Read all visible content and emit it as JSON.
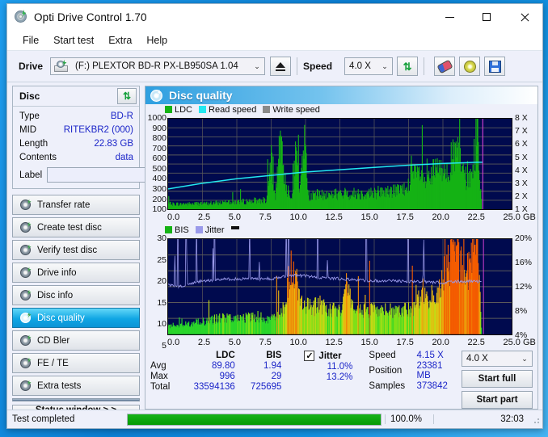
{
  "window": {
    "title": "Opti Drive Control 1.70",
    "icon": "disc-lightning-icon",
    "controls": {
      "minimize": "—",
      "maximize": "□",
      "close": "✕"
    }
  },
  "menu": {
    "items": [
      "File",
      "Start test",
      "Extra",
      "Help"
    ]
  },
  "toolbar": {
    "drive_label": "Drive",
    "drive_value": "(F:)  PLEXTOR BD-R  PX-LB950SA 1.04",
    "eject_title": "Eject",
    "speed_label": "Speed",
    "speed_value": "4.0 X",
    "buttons": [
      "refresh-icon",
      "eraser-icon",
      "disc-tools-icon",
      "save-icon"
    ]
  },
  "disc": {
    "header": "Disc",
    "refresh_icon": "refresh-icon",
    "fields": [
      {
        "key": "Type",
        "value": "BD-R"
      },
      {
        "key": "MID",
        "value": "RITEKBR2 (000)"
      },
      {
        "key": "Length",
        "value": "22.83 GB"
      },
      {
        "key": "Contents",
        "value": "data"
      }
    ],
    "label_key": "Label",
    "label_value": "",
    "label_placeholder": ""
  },
  "nav": {
    "items": [
      {
        "label": "Transfer rate",
        "active": false
      },
      {
        "label": "Create test disc",
        "active": false
      },
      {
        "label": "Verify test disc",
        "active": false
      },
      {
        "label": "Drive info",
        "active": false
      },
      {
        "label": "Disc info",
        "active": false
      },
      {
        "label": "Disc quality",
        "active": true
      },
      {
        "label": "CD Bler",
        "active": false
      },
      {
        "label": "FE / TE",
        "active": false
      },
      {
        "label": "Extra tests",
        "active": false
      }
    ],
    "status_window": "Status window > >"
  },
  "panel": {
    "title": "Disc quality",
    "icon": "disc-lightning-icon"
  },
  "chart_data": [
    {
      "type": "area",
      "title": "LDC / Read speed",
      "legend": [
        {
          "label": "LDC",
          "color": "#15b215"
        },
        {
          "label": "Read speed",
          "color": "#23e8f0"
        },
        {
          "label": "Write speed",
          "color": "#8a8a8a"
        }
      ],
      "legend_position": "top-left",
      "xlabel": "GB",
      "ylabel": "LDC",
      "y2label": "Speed",
      "xlim": [
        0,
        25
      ],
      "ylim": [
        0,
        1000
      ],
      "y2lim": [
        0,
        8
      ],
      "xticks": [
        "0.0",
        "2.5",
        "5.0",
        "7.5",
        "10.0",
        "12.5",
        "15.0",
        "17.5",
        "20.0",
        "22.5",
        "25.0 GB"
      ],
      "yticks": [
        "1000",
        "900",
        "800",
        "700",
        "600",
        "500",
        "400",
        "300",
        "200",
        "100"
      ],
      "y2ticks": [
        "8 X",
        "7 X",
        "6 X",
        "5 X",
        "4 X",
        "3 X",
        "2 X",
        "1 X"
      ],
      "grid": true,
      "background": "#000a4e",
      "series": [
        {
          "name": "LDC",
          "type": "area",
          "color": "#15b215",
          "x": [
            0.0,
            0.3,
            0.6,
            0.9,
            1.2,
            1.5,
            1.8,
            2.1,
            2.4,
            2.7,
            3.0,
            3.3,
            3.6,
            3.9,
            4.2,
            4.5,
            4.8,
            5.1,
            5.4,
            5.7,
            6.0,
            6.3,
            6.6,
            6.9,
            7.2,
            7.5,
            7.8,
            8.1,
            8.4,
            8.7,
            9.0,
            9.3,
            9.6,
            9.9,
            10.2,
            10.5,
            10.8,
            11.1,
            11.4,
            11.7,
            12.0,
            12.3,
            12.6,
            12.9,
            13.2,
            13.5,
            13.8,
            14.1,
            14.4,
            14.7,
            15.0,
            15.3,
            15.6,
            15.9,
            16.2,
            16.5,
            16.8,
            17.1,
            17.4,
            17.7,
            18.0,
            18.3,
            18.6,
            18.9,
            19.2,
            19.5,
            19.8,
            20.1,
            20.4,
            20.7,
            21.0,
            21.3,
            21.6,
            21.9,
            22.2,
            22.5,
            22.8
          ],
          "y": [
            60,
            55,
            58,
            52,
            60,
            57,
            55,
            62,
            58,
            60,
            65,
            62,
            68,
            70,
            95,
            80,
            75,
            78,
            82,
            85,
            88,
            90,
            92,
            95,
            98,
            500,
            110,
            720,
            430,
            200,
            170,
            560,
            180,
            800,
            150,
            140,
            160,
            145,
            155,
            150,
            165,
            160,
            150,
            170,
            155,
            165,
            175,
            160,
            180,
            170,
            175,
            185,
            180,
            190,
            185,
            200,
            195,
            210,
            205,
            420,
            330,
            390,
            280,
            300,
            360,
            420,
            390,
            440,
            480,
            520,
            600,
            480,
            330,
            300,
            460,
            860,
            90
          ]
        },
        {
          "name": "Read speed",
          "type": "line",
          "color": "#23e8f0",
          "x": [
            0.0,
            2.5,
            5.0,
            7.5,
            10.0,
            12.5,
            15.0,
            17.5,
            20.0,
            22.5,
            22.9
          ],
          "y_in_x_units": [
            1.8,
            2.3,
            2.7,
            3.0,
            3.3,
            3.5,
            3.7,
            3.9,
            4.05,
            4.15,
            4.15
          ]
        }
      ]
    },
    {
      "type": "area",
      "title": "BIS / Jitter",
      "legend": [
        {
          "label": "BIS",
          "color": "#15b215"
        },
        {
          "label": "Jitter",
          "color": "#9a9aea"
        }
      ],
      "legend_position": "top-left",
      "xlabel": "GB",
      "ylabel": "BIS",
      "y2label": "Jitter %",
      "xlim": [
        0,
        25
      ],
      "ylim": [
        0,
        30
      ],
      "y2lim": [
        0,
        20
      ],
      "xticks": [
        "0.0",
        "2.5",
        "5.0",
        "7.5",
        "10.0",
        "12.5",
        "15.0",
        "17.5",
        "20.0",
        "22.5",
        "25.0 GB"
      ],
      "yticks": [
        "30",
        "25",
        "20",
        "15",
        "10",
        "5"
      ],
      "y2ticks": [
        "20%",
        "16%",
        "12%",
        "8%",
        "4%"
      ],
      "grid": true,
      "background": "#000a4e",
      "series": [
        {
          "name": "BIS",
          "type": "area",
          "color": "#15b215",
          "x": [
            0.0,
            0.5,
            1.0,
            1.5,
            2.0,
            2.5,
            3.0,
            3.5,
            4.0,
            4.5,
            5.0,
            5.5,
            6.0,
            6.5,
            7.0,
            7.5,
            8.0,
            8.5,
            9.0,
            9.5,
            10.0,
            10.5,
            11.0,
            11.5,
            12.0,
            12.5,
            13.0,
            13.5,
            14.0,
            14.5,
            15.0,
            15.5,
            16.0,
            16.5,
            17.0,
            17.5,
            18.0,
            18.5,
            19.0,
            19.5,
            20.0,
            20.5,
            21.0,
            21.5,
            22.0,
            22.5,
            22.8
          ],
          "y": [
            2.5,
            2.8,
            2.6,
            3.2,
            3.5,
            3.8,
            4.2,
            4.6,
            5.0,
            5.2,
            4.8,
            5.0,
            5.2,
            5.4,
            5.0,
            4.9,
            5.2,
            9.0,
            21.0,
            13.0,
            8.5,
            8.0,
            9.0,
            7.5,
            8.0,
            7.0,
            16.0,
            7.5,
            7.0,
            7.2,
            7.5,
            7.0,
            7.2,
            6.8,
            7.0,
            7.5,
            8.0,
            14.0,
            11.0,
            13.0,
            16.0,
            22.0,
            25.0,
            21.0,
            20.0,
            29.0,
            3.0
          ]
        },
        {
          "name": "Jitter",
          "type": "line",
          "color": "#9a9aea",
          "x": [
            0.0,
            1.0,
            2.0,
            3.0,
            4.0,
            5.0,
            6.0,
            7.0,
            8.0,
            9.0,
            10.0,
            11.0,
            12.0,
            13.0,
            14.0,
            15.0,
            16.0,
            17.0,
            18.0,
            19.0,
            20.0,
            21.0,
            22.0,
            22.8
          ],
          "y_pct": [
            10.3,
            10.0,
            11.0,
            11.3,
            11.5,
            11.6,
            11.6,
            11.6,
            11.8,
            12.3,
            12.2,
            11.8,
            11.7,
            11.5,
            11.3,
            11.2,
            11.2,
            11.1,
            11.0,
            10.9,
            10.8,
            11.0,
            11.2,
            11.0
          ]
        }
      ]
    }
  ],
  "stats": {
    "columns": [
      "LDC",
      "BIS"
    ],
    "rows": [
      {
        "key": "Avg",
        "ldc": "89.80",
        "bis": "1.94",
        "jitter": "11.0%"
      },
      {
        "key": "Max",
        "ldc": "996",
        "bis": "29",
        "jitter": "13.2%"
      },
      {
        "key": "Total",
        "ldc": "33594136",
        "bis": "725695",
        "jitter": ""
      }
    ],
    "jitter_label": "Jitter",
    "jitter_checked": true,
    "speed_label": "Speed",
    "speed_value": "4.15 X",
    "position_label": "Position",
    "position_value": "23381 MB",
    "samples_label": "Samples",
    "samples_value": "373842",
    "speed_select": "4.0 X",
    "start_full": "Start full",
    "start_part": "Start part"
  },
  "statusbar": {
    "text": "Test completed",
    "progress_pct": "100.0%",
    "progress_value": 100,
    "elapsed": "32:03"
  },
  "colors": {
    "accent": "#0b93d6",
    "link_value": "#1a24c8",
    "plot_bg": "#000a4e",
    "ldc_green": "#15b215",
    "read_speed": "#23e8f0",
    "jitter": "#9a9aea",
    "progress": "#0a9a0a"
  }
}
